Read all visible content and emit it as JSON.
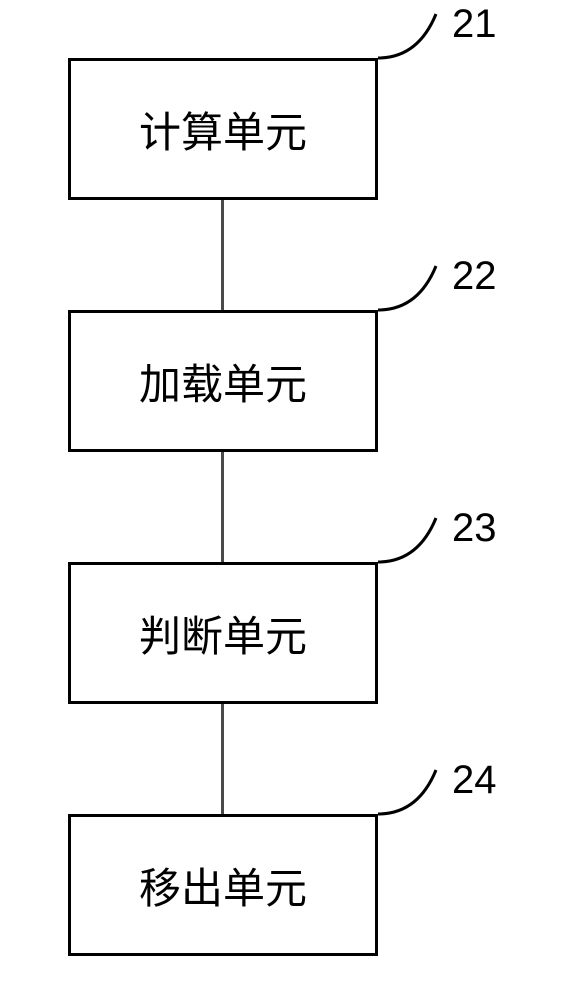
{
  "diagram": {
    "boxes": [
      {
        "label": "计算单元",
        "ref": "21"
      },
      {
        "label": "加载单元",
        "ref": "22"
      },
      {
        "label": "判断单元",
        "ref": "23"
      },
      {
        "label": "移出单元",
        "ref": "24"
      }
    ]
  }
}
